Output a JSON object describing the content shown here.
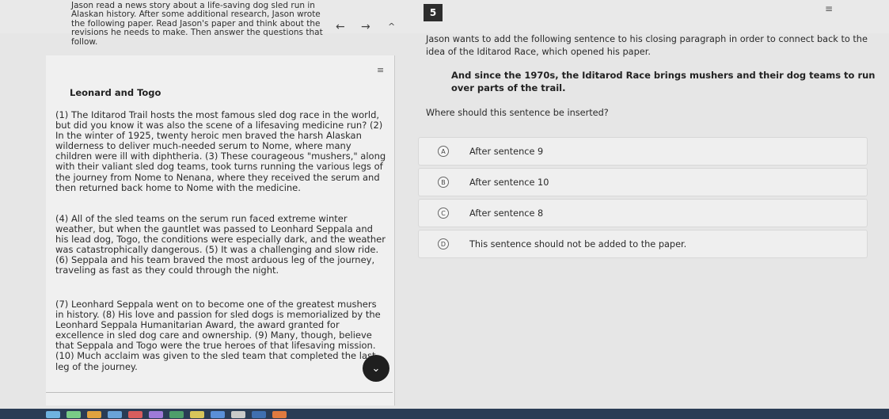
{
  "header": {
    "intro": "Jason read a news story about a life-saving dog sled run in Alaskan history. After some additional research, Jason wrote the following paper. Read Jason's paper and think about the revisions he needs to make. Then answer the questions that follow.",
    "question_number": "5",
    "back_arrow": "←",
    "forward_arrow": "→",
    "collapse_arrow": "^",
    "menu_icon": "≡"
  },
  "passage": {
    "toggle_icon": "≡",
    "title": "Leonard and Togo",
    "paragraphs": [
      "(1) The Iditarod Trail hosts the most famous sled dog race in the world, but did you know it was also the scene of a lifesaving medicine run? (2) In the winter of 1925, twenty heroic men braved the harsh Alaskan wilderness to deliver much-needed serum to Nome, where many children were ill with diphtheria. (3) These courageous \"mushers,\" along with their valiant sled dog teams, took turns running the various legs of the journey from Nome to Nenana, where they received the serum and then returned back home to Nome with the medicine.",
      "(4) All of the sled teams on the serum run faced extreme winter weather, but when the gauntlet was passed to Leonhard Seppala and his lead dog, Togo, the conditions were especially dark, and the weather was catastrophically dangerous. (5) It was a challenging and slow ride. (6) Seppala and his team braved the most arduous leg of the journey, traveling as fast as they could through the night.",
      "(7) Leonhard Seppala went on to become one of the greatest mushers in history. (8) His love and passion for sled dogs is memorialized by the Leonhard Seppala Humanitarian Award, the award granted for excellence in sled dog care and ownership. (9) Many, though, believe that Seppala and Togo were the true heroes of that lifesaving mission. (10) Much acclaim was given to the sled team that completed the last leg of the journey."
    ],
    "scroll_icon": "⌄"
  },
  "question": {
    "prompt": "Jason wants to add the following sentence to his closing paragraph in order to connect back to the idea of the Iditarod Race, which opened his paper.",
    "quote": "And since the 1970s, the Iditarod Race brings mushers and their dog teams to run over parts of the trail.",
    "ask": "Where should this sentence be inserted?",
    "options": [
      {
        "letter": "A",
        "text": "After sentence 9"
      },
      {
        "letter": "B",
        "text": "After sentence 10"
      },
      {
        "letter": "C",
        "text": "After sentence 8"
      },
      {
        "letter": "D",
        "text": "This sentence should not be added to the paper."
      }
    ]
  },
  "colors": {
    "background": "#e6e6e6",
    "panel": "#f0f0f0",
    "dark_button": "#1f1f1f",
    "dock": "#2a3c55"
  }
}
